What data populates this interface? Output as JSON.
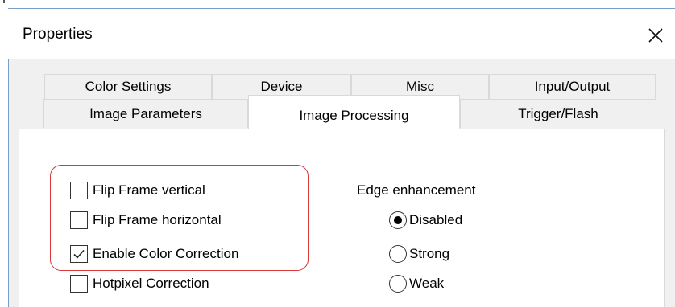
{
  "window": {
    "title": "Properties"
  },
  "tabs": {
    "row1": [
      "Color Settings",
      "Device",
      "Misc",
      "Input/Output"
    ],
    "row2": [
      "Image Parameters",
      "Image Processing",
      "Trigger/Flash"
    ],
    "active": "Image Processing"
  },
  "options": {
    "flip_vertical": {
      "label": "Flip Frame vertical",
      "checked": false
    },
    "flip_horizontal": {
      "label": "Flip Frame horizontal",
      "checked": false
    },
    "color_correction": {
      "label": "Enable Color Correction",
      "checked": true
    },
    "hotpixel": {
      "label": "Hotpixel Correction",
      "checked": false
    }
  },
  "edge_enhancement": {
    "label": "Edge enhancement",
    "options": [
      "Disabled",
      "Strong",
      "Weak"
    ],
    "selected": "Disabled"
  },
  "colors": {
    "highlight": "#d9383a",
    "window_border": "#7a9ec8"
  },
  "icons": {
    "close": "close-icon",
    "check": "checkmark-icon"
  }
}
